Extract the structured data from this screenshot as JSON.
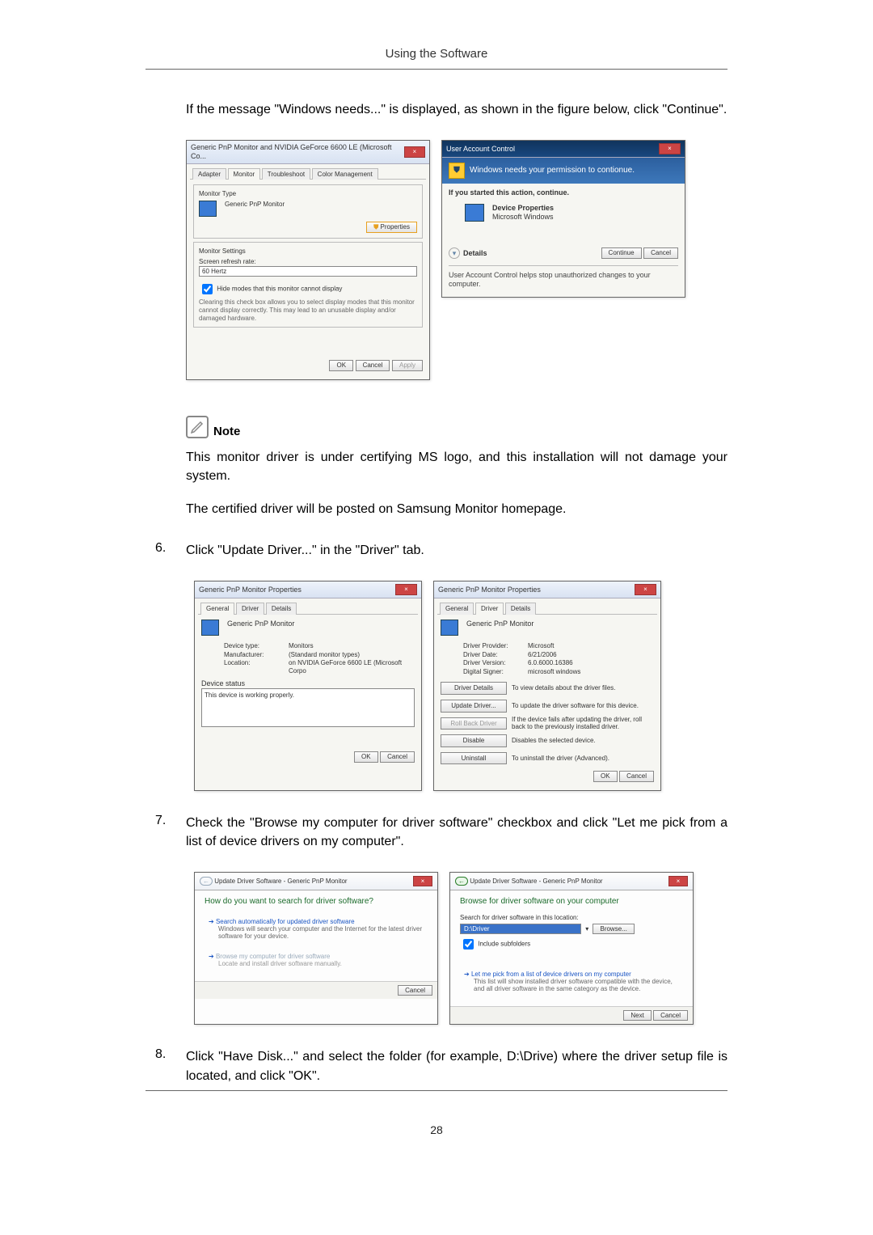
{
  "doc": {
    "header": "Using the Software",
    "intro": "If the message \"Windows needs...\" is displayed, as shown in the figure below, click \"Continue\".",
    "note_label": "Note",
    "note_body1": "This monitor driver is under certifying MS logo, and this installation will not damage your system.",
    "note_body2": "The certified driver will be posted on Samsung Monitor homepage.",
    "step6_num": "6.",
    "step6": "Click \"Update Driver...\" in the \"Driver\" tab.",
    "step7_num": "7.",
    "step7": "Check the \"Browse my computer for driver software\" checkbox and click \"Let me pick from a list of device drivers on my computer\".",
    "step8_num": "8.",
    "step8": "Click \"Have Disk...\" and select the folder (for example, D:\\Drive) where the driver setup file is located, and click \"OK\".",
    "page_number": "28"
  },
  "dlg1": {
    "title": "Generic PnP Monitor and NVIDIA GeForce 6600 LE (Microsoft Co...",
    "tabs": [
      "Adapter",
      "Monitor",
      "Troubleshoot",
      "Color Management"
    ],
    "monitor_type_label": "Monitor Type",
    "monitor_type": "Generic PnP Monitor",
    "properties_btn": "Properties",
    "settings_label": "Monitor Settings",
    "refresh_label": "Screen refresh rate:",
    "refresh_value": "60 Hertz",
    "hide_modes_chk": "Hide modes that this monitor cannot display",
    "hide_modes_note": "Clearing this check box allows you to select display modes that this monitor cannot display correctly. This may lead to an unusable display and/or damaged hardware.",
    "ok": "OK",
    "cancel": "Cancel",
    "apply": "Apply"
  },
  "dlg2": {
    "title": "User Account Control",
    "headline": "Windows needs your permission to contionue.",
    "sub": "If you started this action, continue.",
    "app_name": "Device Properties",
    "publisher": "Microsoft Windows",
    "details": "Details",
    "continue": "Continue",
    "cancel": "Cancel",
    "footer": "User Account Control helps stop unauthorized changes to your computer."
  },
  "dlg3": {
    "title": "Generic PnP Monitor Properties",
    "tabs": [
      "General",
      "Driver",
      "Details"
    ],
    "device": "Generic PnP Monitor",
    "kv": {
      "type_l": "Device type:",
      "type_v": "Monitors",
      "manuf_l": "Manufacturer:",
      "manuf_v": "(Standard monitor types)",
      "loc_l": "Location:",
      "loc_v": "on NVIDIA GeForce 6600 LE (Microsoft Corpo"
    },
    "status_l": "Device status",
    "status_v": "This device is working properly.",
    "ok": "OK",
    "cancel": "Cancel"
  },
  "dlg4": {
    "title": "Generic PnP Monitor Properties",
    "tabs": [
      "General",
      "Driver",
      "Details"
    ],
    "device": "Generic PnP Monitor",
    "kv": {
      "prov_l": "Driver Provider:",
      "prov_v": "Microsoft",
      "date_l": "Driver Date:",
      "date_v": "6/21/2006",
      "ver_l": "Driver Version:",
      "ver_v": "6.0.6000.16386",
      "sig_l": "Digital Signer:",
      "sig_v": "microsoft windows"
    },
    "btns": {
      "details": {
        "l": "Driver Details",
        "d": "To view details about the driver files."
      },
      "update": {
        "l": "Update Driver...",
        "d": "To update the driver software for this device."
      },
      "rollback": {
        "l": "Roll Back Driver",
        "d": "If the device fails after updating the driver, roll back to the previously installed driver."
      },
      "disable": {
        "l": "Disable",
        "d": "Disables the selected device."
      },
      "uninstall": {
        "l": "Uninstall",
        "d": "To uninstall the driver (Advanced)."
      }
    },
    "ok": "OK",
    "cancel": "Cancel"
  },
  "wiz1": {
    "crumb": "Update Driver Software - Generic PnP Monitor",
    "heading": "How do you want to search for driver software?",
    "opt1_lead": "Search automatically for updated driver software",
    "opt1_sub": "Windows will search your computer and the Internet for the latest driver software for your device.",
    "opt2_lead": "Browse my computer for driver software",
    "opt2_sub": "Locate and install driver software manually.",
    "cancel": "Cancel"
  },
  "wiz2": {
    "crumb": "Update Driver Software - Generic PnP Monitor",
    "heading": "Browse for driver software on your computer",
    "path_label": "Search for driver software in this location:",
    "path_value": "D:\\Driver",
    "browse": "Browse...",
    "subfolders": "Include subfolders",
    "opt_lead": "Let me pick from a list of device drivers on my computer",
    "opt_sub": "This list will show installed driver software compatible with the device, and all driver software in the same category as the device.",
    "next": "Next",
    "cancel": "Cancel"
  }
}
